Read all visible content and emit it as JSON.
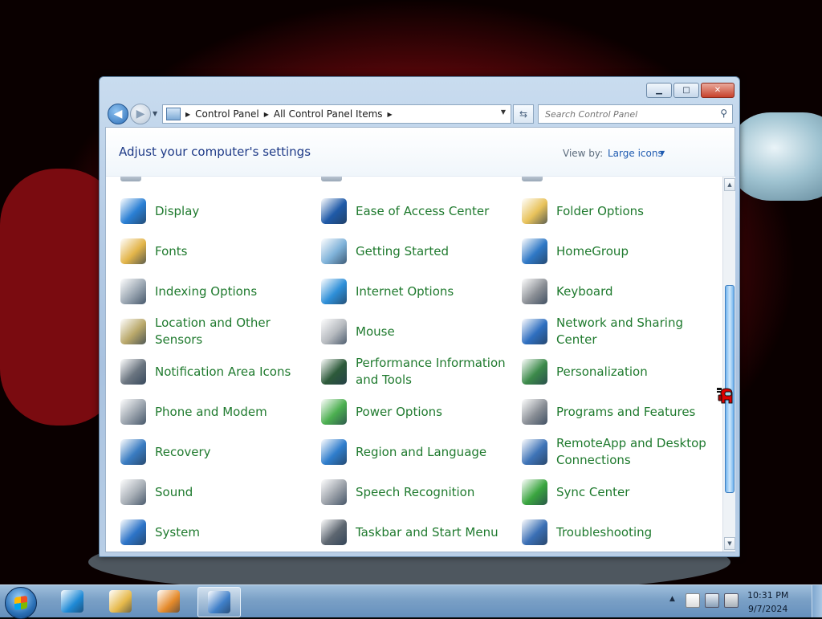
{
  "window": {
    "caption": {
      "minimize": "▁",
      "maximize": "□",
      "close": "✕"
    },
    "address": {
      "crumbs": [
        "Control Panel",
        "All Control Panel Items"
      ]
    },
    "search": {
      "placeholder": "Search Control Panel"
    },
    "header": {
      "title": "Adjust your computer's settings",
      "view_by_label": "View by:",
      "view_by_value": "Large icons"
    },
    "items": [
      {
        "label": "Display",
        "icon": "display-icon",
        "color": "#2a7fd4"
      },
      {
        "label": "Ease of Access Center",
        "icon": "ease-of-access-icon",
        "color": "#1f5aa8"
      },
      {
        "label": "Folder Options",
        "icon": "folder-options-icon",
        "color": "#e8c25a"
      },
      {
        "label": "Fonts",
        "icon": "fonts-icon",
        "color": "#e3b54a"
      },
      {
        "label": "Getting Started",
        "icon": "getting-started-icon",
        "color": "#7fb2d9"
      },
      {
        "label": "HomeGroup",
        "icon": "homegroup-icon",
        "color": "#2f78c6"
      },
      {
        "label": "Indexing Options",
        "icon": "indexing-options-icon",
        "color": "#9aa6b2"
      },
      {
        "label": "Internet Options",
        "icon": "internet-options-icon",
        "color": "#2e8fd8"
      },
      {
        "label": "Keyboard",
        "icon": "keyboard-icon",
        "color": "#8c9096"
      },
      {
        "label": "Location and Other Sensors",
        "icon": "location-sensors-icon",
        "color": "#b9a86a"
      },
      {
        "label": "Mouse",
        "icon": "mouse-icon",
        "color": "#b5b9be"
      },
      {
        "label": "Network and Sharing Center",
        "icon": "network-sharing-icon",
        "color": "#2f6fc0"
      },
      {
        "label": "Notification Area Icons",
        "icon": "notification-area-icon",
        "color": "#6b7580"
      },
      {
        "label": "Performance Information and Tools",
        "icon": "performance-icon",
        "color": "#2d5a3a"
      },
      {
        "label": "Personalization",
        "icon": "personalization-icon",
        "color": "#3c8a4a"
      },
      {
        "label": "Phone and Modem",
        "icon": "phone-modem-icon",
        "color": "#9aa3ad"
      },
      {
        "label": "Power Options",
        "icon": "power-options-icon",
        "color": "#4caf50"
      },
      {
        "label": "Programs and Features",
        "icon": "programs-features-icon",
        "color": "#8a8f96"
      },
      {
        "label": "Recovery",
        "icon": "recovery-icon",
        "color": "#3a7cc2"
      },
      {
        "label": "Region and Language",
        "icon": "region-language-icon",
        "color": "#2f7dcc"
      },
      {
        "label": "RemoteApp and Desktop Connections",
        "icon": "remoteapp-icon",
        "color": "#3f74b8"
      },
      {
        "label": "Sound",
        "icon": "sound-icon",
        "color": "#a7aeb6"
      },
      {
        "label": "Speech Recognition",
        "icon": "speech-recognition-icon",
        "color": "#9aa0a8"
      },
      {
        "label": "Sync Center",
        "icon": "sync-center-icon",
        "color": "#3aa53f"
      },
      {
        "label": "System",
        "icon": "system-icon",
        "color": "#2d74c8"
      },
      {
        "label": "Taskbar and Start Menu",
        "icon": "taskbar-start-menu-icon",
        "color": "#5d6670"
      },
      {
        "label": "Troubleshooting",
        "icon": "troubleshooting-icon",
        "color": "#3a6fb5"
      }
    ]
  },
  "taskbar": {
    "apps": [
      {
        "name": "internet-explorer",
        "color": "#1f8ad6"
      },
      {
        "name": "windows-explorer",
        "color": "#e6b94a"
      },
      {
        "name": "media-player",
        "color": "#e58a2a"
      },
      {
        "name": "control-panel",
        "color": "#3f7fc8",
        "active": true
      }
    ],
    "clock": {
      "time": "10:31 PM",
      "date": "9/7/2024"
    }
  }
}
